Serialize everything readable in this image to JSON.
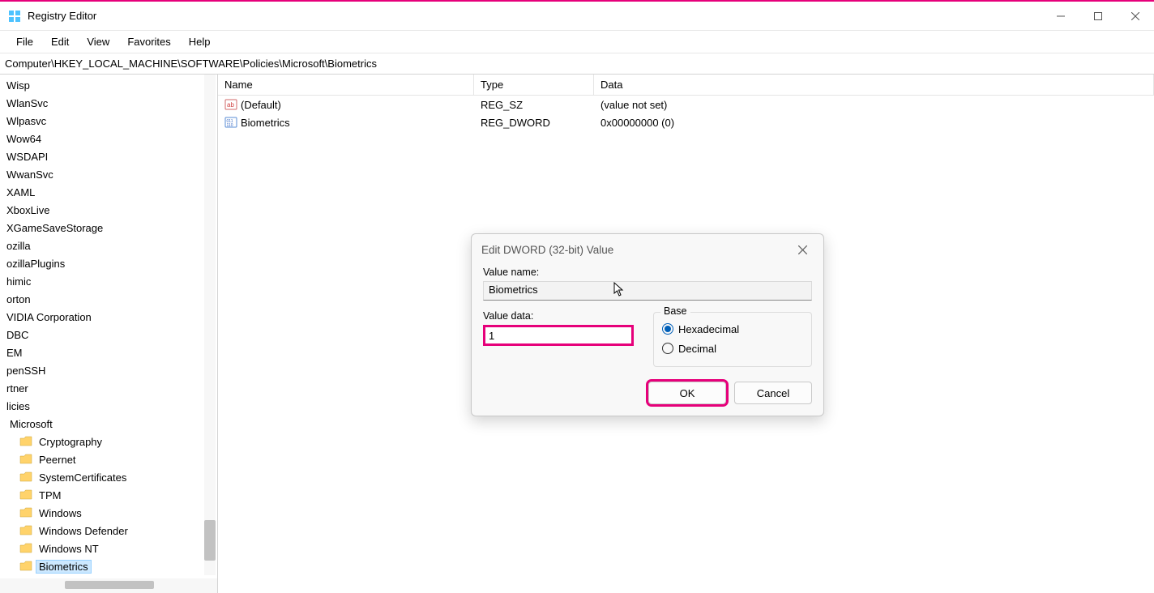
{
  "title": "Registry Editor",
  "menus": [
    "File",
    "Edit",
    "View",
    "Favorites",
    "Help"
  ],
  "address": "Computer\\HKEY_LOCAL_MACHINE\\SOFTWARE\\Policies\\Microsoft\\Biometrics",
  "tree": [
    {
      "label": "Wisp",
      "indent": 0,
      "folder": false
    },
    {
      "label": "WlanSvc",
      "indent": 0,
      "folder": false
    },
    {
      "label": "Wlpasvc",
      "indent": 0,
      "folder": false
    },
    {
      "label": "Wow64",
      "indent": 0,
      "folder": false
    },
    {
      "label": "WSDAPI",
      "indent": 0,
      "folder": false
    },
    {
      "label": "WwanSvc",
      "indent": 0,
      "folder": false
    },
    {
      "label": "XAML",
      "indent": 0,
      "folder": false
    },
    {
      "label": "XboxLive",
      "indent": 0,
      "folder": false
    },
    {
      "label": "XGameSaveStorage",
      "indent": 0,
      "folder": false
    },
    {
      "label": "ozilla",
      "indent": 0,
      "folder": false
    },
    {
      "label": "ozillaPlugins",
      "indent": 0,
      "folder": false
    },
    {
      "label": "himic",
      "indent": 0,
      "folder": false
    },
    {
      "label": "orton",
      "indent": 0,
      "folder": false
    },
    {
      "label": "VIDIA Corporation",
      "indent": 0,
      "folder": false
    },
    {
      "label": "DBC",
      "indent": 0,
      "folder": false
    },
    {
      "label": "EM",
      "indent": 0,
      "folder": false
    },
    {
      "label": "penSSH",
      "indent": 0,
      "folder": false
    },
    {
      "label": "rtner",
      "indent": 0,
      "folder": false
    },
    {
      "label": "licies",
      "indent": 0,
      "folder": false
    },
    {
      "label": "Microsoft",
      "indent": 4,
      "folder": false
    },
    {
      "label": "Cryptography",
      "indent": 20,
      "folder": true
    },
    {
      "label": "Peernet",
      "indent": 20,
      "folder": true
    },
    {
      "label": "SystemCertificates",
      "indent": 20,
      "folder": true
    },
    {
      "label": "TPM",
      "indent": 20,
      "folder": true
    },
    {
      "label": "Windows",
      "indent": 20,
      "folder": true
    },
    {
      "label": "Windows Defender",
      "indent": 20,
      "folder": true
    },
    {
      "label": "Windows NT",
      "indent": 20,
      "folder": true
    },
    {
      "label": "Biometrics",
      "indent": 20,
      "folder": true,
      "selected": true
    }
  ],
  "list": {
    "columns": [
      "Name",
      "Type",
      "Data"
    ],
    "rows": [
      {
        "icon": "sz",
        "name": "(Default)",
        "type": "REG_SZ",
        "data_": "(value not set)"
      },
      {
        "icon": "dw",
        "name": "Biometrics",
        "type": "REG_DWORD",
        "data_": "0x00000000 (0)"
      }
    ]
  },
  "dialog": {
    "title": "Edit DWORD (32-bit) Value",
    "label_name": "Value name:",
    "value_name": "Biometrics",
    "label_data": "Value data:",
    "value_data": "1",
    "base_label": "Base",
    "opt_hex": "Hexadecimal",
    "opt_dec": "Decimal",
    "ok": "OK",
    "cancel": "Cancel"
  }
}
